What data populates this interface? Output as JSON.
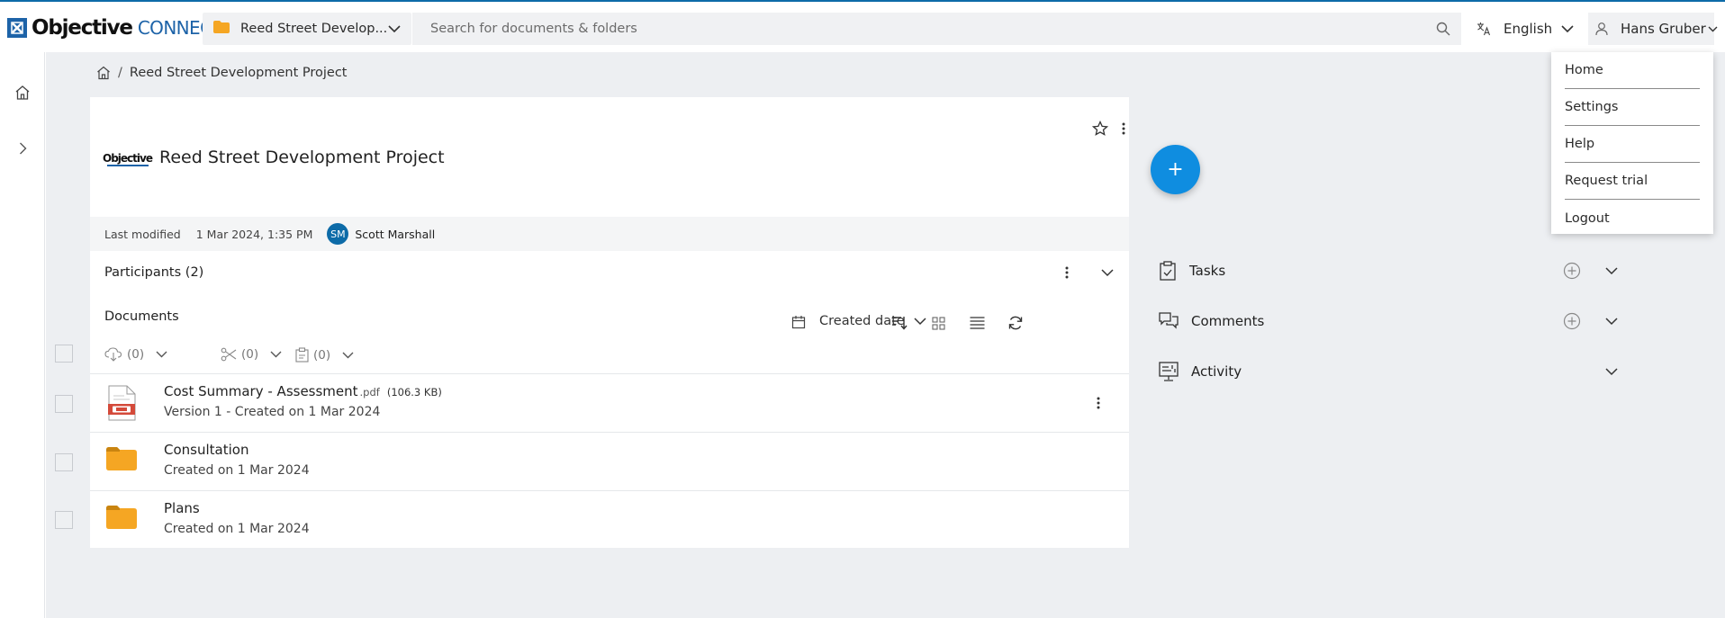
{
  "app": {
    "logo_text_bold": "Objective",
    "logo_text_light": "CONNECT"
  },
  "header": {
    "workspace_name": "Reed Street Develop...",
    "search_placeholder": "Search for documents & folders",
    "language": "English",
    "user_name": "Hans Gruber"
  },
  "user_menu": {
    "items": [
      "Home",
      "Settings",
      "Help",
      "Request trial",
      "Logout"
    ]
  },
  "breadcrumb": {
    "current": "Reed Street Development Project"
  },
  "project": {
    "logo_text": "Objective",
    "title": "Reed Street Development Project",
    "last_modified_label": "Last modified",
    "last_modified_date": "1 Mar 2024, 1:35 PM",
    "modified_by_initials": "SM",
    "modified_by_name": "Scott Marshall"
  },
  "participants": {
    "label": "Participants (2)"
  },
  "documents": {
    "title": "Documents",
    "sort_label": "Created date",
    "download_count": "(0)",
    "share_count": "(0)",
    "clipboard_count": "(0)",
    "items": [
      {
        "type": "pdf",
        "name": "Cost Summary - Assessment",
        "ext": ".pdf",
        "size": "(106.3 KB)",
        "subtitle": "Version 1 - Created on 1 Mar 2024"
      },
      {
        "type": "folder",
        "name": "Consultation",
        "subtitle": "Created on 1 Mar 2024"
      },
      {
        "type": "folder",
        "name": "Plans",
        "subtitle": "Created on 1 Mar 2024"
      }
    ]
  },
  "side_panels": {
    "tasks": "Tasks",
    "comments": "Comments",
    "activity": "Activity"
  },
  "fab": {
    "symbol": "+"
  },
  "colors": {
    "brand_blue": "#1d63a8",
    "fab_blue": "#0f8de0",
    "folder_orange": "#f5a623",
    "background": "#edeff2"
  }
}
